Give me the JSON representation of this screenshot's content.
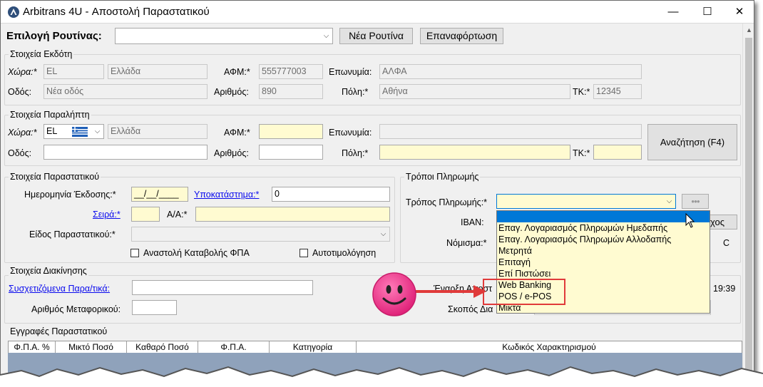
{
  "window": {
    "title": "Arbitrans 4U - Αποστολή Παραστατικού",
    "min_glyph": "—",
    "max_glyph": "☐",
    "close_glyph": "✕"
  },
  "routine": {
    "label": "Επιλογή Ρουτίνας:",
    "value": "",
    "new_button": "Νέα Ρουτίνα",
    "reload_button": "Επαναφόρτωση"
  },
  "issuer": {
    "title": "Στοιχεία Εκδότη",
    "country_label": "Χώρα:*",
    "country_code": "EL",
    "country_name": "Ελλάδα",
    "afm_label": "ΑΦΜ:*",
    "afm": "555777003",
    "name_label": "Επωνυμία:",
    "name": "ΑΛΦΑ",
    "street_label": "Οδός:",
    "street": "Νέα οδός",
    "number_label": "Αριθμός:",
    "number": "890",
    "city_label": "Πόλη:*",
    "city": "Αθήνα",
    "zip_label": "ΤΚ:*",
    "zip": "12345"
  },
  "recipient": {
    "title": "Στοιχεία Παραλήπτη",
    "country_label": "Χώρα:*",
    "country_code": "EL",
    "country_name": "Ελλάδα",
    "afm_label": "ΑΦΜ:*",
    "afm": "",
    "name_label": "Επωνυμία:",
    "name": "",
    "street_label": "Οδός:",
    "street": "",
    "number_label": "Αριθμός:",
    "number": "",
    "city_label": "Πόλη:*",
    "city": "",
    "zip_label": "ΤΚ:*",
    "zip": "",
    "search_button": "Αναζήτηση (F4)"
  },
  "document": {
    "title": "Στοιχεία Παραστατικού",
    "date_label": "Ημερομηνία Έκδοσης:*",
    "date_value": "__/__/____",
    "branch_link": "Υποκατάστημα:*",
    "branch_value": "0",
    "series_link": "Σειρά:*",
    "series_value": "",
    "aa_label": "Α/Α:*",
    "aa_value": "",
    "type_label": "Είδος Παραστατικού:*",
    "type_value": "",
    "vat_suspend_label": "Αναστολή Καταβολής ΦΠΑ",
    "self_invoice_label": "Αυτοτιμολόγηση"
  },
  "payment": {
    "title": "Τρόποι Πληρωμής",
    "method_label": "Τρόπος Πληρωμής:*",
    "method_value": "",
    "dots_glyph": "●●●",
    "iban_label": "IBAN:",
    "currency_label": "Νόμισμα:*",
    "partial_button": "χος",
    "partial_currency": "C",
    "options": [
      "Επαγ. Λογαριασμός Πληρωμών Ημεδαπής",
      "Επαγ. Λογαριασμός Πληρωμών Αλλοδαπής",
      "Μετρητά",
      "Επιταγή",
      "Επί Πιστώσει",
      "Web Banking",
      "POS / e-POS",
      "Μικτά"
    ]
  },
  "movement": {
    "title": "Στοιχεία Διακίνησης",
    "related_link": "Συσχετιζόμενα Παρα/τικά:",
    "related_value": "",
    "vehicle_label": "Αριθμός Μεταφορικού:",
    "vehicle_value": "",
    "start_label_partial": "Έναρξη Αποστ",
    "purpose_label_partial": "Σκοπός Δια",
    "time_value": "19:39"
  },
  "lines": {
    "title": "Εγγραφές Παραστατικού",
    "columns": [
      "Φ.Π.Α. %",
      "Μικτό Ποσό",
      "Καθαρό Ποσό",
      "Φ.Π.Α.",
      "Κατηγορία",
      "Κωδικός Χαρακτηρισμού"
    ]
  },
  "colors": {
    "required_field": "#fffbd1",
    "highlight_border": "#e03a3a",
    "arrow": "#e03a3a",
    "smiley": "#f0378c",
    "selection": "#0078d7",
    "link": "#0a0aee",
    "grid_body": "#8fa2bb"
  },
  "icons": {
    "app": "arbitrans-logo-icon",
    "flag": "greek-flag-icon",
    "smiley": "smiley-face-icon",
    "cursor": "mouse-pointer-icon"
  }
}
